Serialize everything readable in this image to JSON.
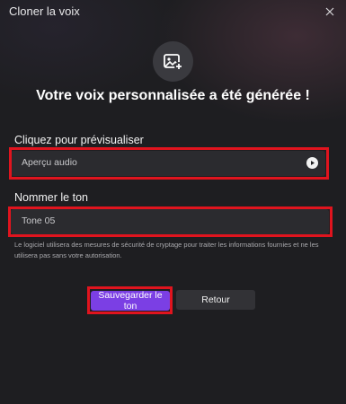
{
  "window": {
    "title": "Cloner la voix",
    "close_icon": "close-icon"
  },
  "hero": {
    "icon": "image-add-icon",
    "headline": "Votre voix personnalisée a été générée !"
  },
  "preview": {
    "label": "Cliquez pour prévisualiser",
    "field_text": "Aperçu audio",
    "play_icon": "play-icon"
  },
  "naming": {
    "label": "Nommer le ton",
    "value": "Tone 05"
  },
  "disclaimer": "Le logiciel utilisera des mesures de sécurité de cryptage pour traiter les informations fournies et ne les utilisera pas sans votre autorisation.",
  "buttons": {
    "save": "Sauvegarder le ton",
    "back": "Retour"
  },
  "colors": {
    "accent": "#7b3fe4",
    "highlight": "#e0141e",
    "background": "#1e1e21"
  }
}
